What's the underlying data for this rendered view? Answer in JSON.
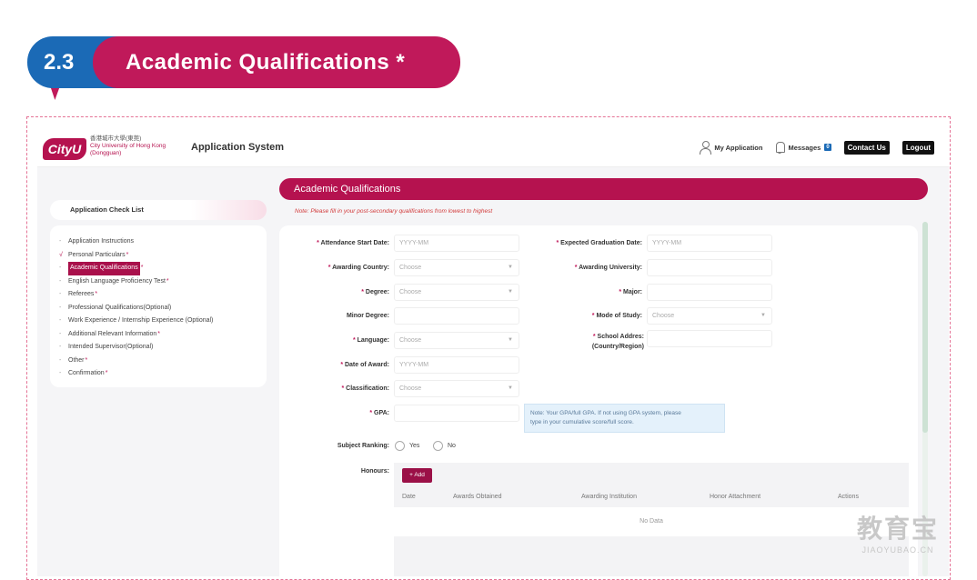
{
  "section": {
    "number": "2.3",
    "title": "Academic Qualifications *"
  },
  "topbar": {
    "logo": "CityU",
    "logo_cn": "香港城市大學(東莞)",
    "logo_en1": "City University of Hong Kong",
    "logo_en2": "(Dongguan)",
    "app_name": "Application System",
    "my_application": "My Application",
    "messages": "Messages",
    "messages_count": "0",
    "contact": "Contact Us",
    "logout": "Logout"
  },
  "sidebar": {
    "title": "Application Check List",
    "items": [
      {
        "mark": "-",
        "label": "Application Instructions",
        "req": ""
      },
      {
        "mark": "√",
        "label": "Personal Particulars",
        "req": "*"
      },
      {
        "mark": "-",
        "label": "Academic Qualifications",
        "req": "*"
      },
      {
        "mark": "-",
        "label": "English Language Proficiency Test",
        "req": "*"
      },
      {
        "mark": "-",
        "label": "Referees",
        "req": "*"
      },
      {
        "mark": "-",
        "label": "Professional Qualifications(Optional)",
        "req": ""
      },
      {
        "mark": "-",
        "label": "Work Experience / Internship Experience (Optional)",
        "req": ""
      },
      {
        "mark": "-",
        "label": "Additional Relevant Information",
        "req": "*"
      },
      {
        "mark": "-",
        "label": "Intended Supervisor(Optional)",
        "req": ""
      },
      {
        "mark": "-",
        "label": "Other",
        "req": "*"
      },
      {
        "mark": "-",
        "label": "Confirmation",
        "req": "*"
      }
    ]
  },
  "main": {
    "heading": "Academic Qualifications",
    "note": "Note: Please fill in your post-secondary qualifications from lowest to highest",
    "fields": {
      "attendance_start": {
        "label": "Attendance Start Date:",
        "placeholder": "YYYY-MM"
      },
      "expected_grad": {
        "label": "Expected Graduation Date:",
        "placeholder": "YYYY-MM"
      },
      "awarding_country": {
        "label": "Awarding Country:",
        "placeholder": "Choose"
      },
      "awarding_university": {
        "label": "Awarding University:",
        "placeholder": ""
      },
      "degree": {
        "label": "Degree:",
        "placeholder": "Choose"
      },
      "major": {
        "label": "Major:",
        "placeholder": ""
      },
      "minor_degree": {
        "label": "Minor Degree:",
        "placeholder": ""
      },
      "mode_of_study": {
        "label": "Mode of Study:",
        "placeholder": "Choose"
      },
      "language": {
        "label": "Language:",
        "placeholder": "Choose"
      },
      "school_address1": "School Addres:",
      "school_address2": "(Country/Region)",
      "date_of_award": {
        "label": "Date of Award:",
        "placeholder": "YYYY-MM"
      },
      "classification": {
        "label": "Classification:",
        "placeholder": "Choose"
      },
      "gpa": {
        "label": "GPA:",
        "placeholder": ""
      },
      "gpa_tip1": "Note: Your GPA/full GPA. If not using GPA system, please",
      "gpa_tip2": "type in your cumulative score/full score.",
      "subject_ranking": {
        "label": "Subject Ranking:",
        "yes": "Yes",
        "no": "No"
      },
      "honours": {
        "label": "Honours:"
      }
    },
    "honours_table": {
      "add_label": "Add",
      "columns": [
        "Date",
        "Awards Obtained",
        "Awarding Institution",
        "Honor Attachment",
        "Actions"
      ],
      "empty": "No Data"
    }
  },
  "watermark": {
    "big": "教育宝",
    "small": "JIAOYUBAO.CN"
  },
  "colors": {
    "brand": "#b5124f",
    "section_num": "#1b6ab6",
    "section_title": "#c0195a"
  }
}
